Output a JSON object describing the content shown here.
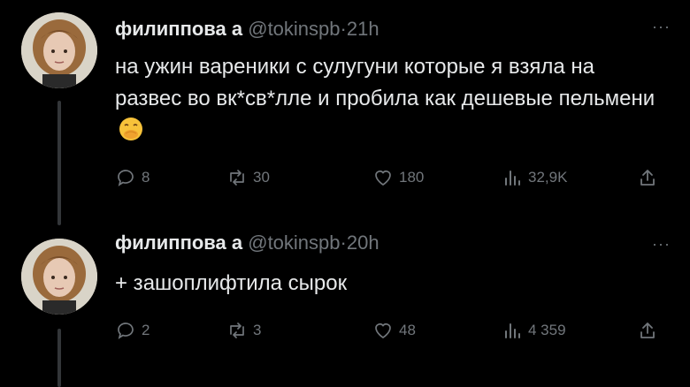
{
  "tweets": [
    {
      "author": {
        "name": "филиппова а",
        "handle": "@tokinspb",
        "time": "21h"
      },
      "text": "на ужин вареники с сулугуни которые я взяла на развес во вк*св*лле и пробила как дешевые пельмени",
      "emoji": "face-with-hand-over-mouth",
      "stats": {
        "replies": "8",
        "reposts": "30",
        "likes": "180",
        "views": "32,9K"
      }
    },
    {
      "author": {
        "name": "филиппова а",
        "handle": "@tokinspb",
        "time": "20h"
      },
      "text": "+ зашоплифтила сырок",
      "stats": {
        "replies": "2",
        "reposts": "3",
        "likes": "48",
        "views": "4 359"
      }
    }
  ],
  "ui": {
    "separator": "·",
    "more": "···"
  },
  "colors": {
    "background": "#000000",
    "text": "#e7e9ea",
    "muted": "#71767b",
    "thread_line": "#333639"
  }
}
